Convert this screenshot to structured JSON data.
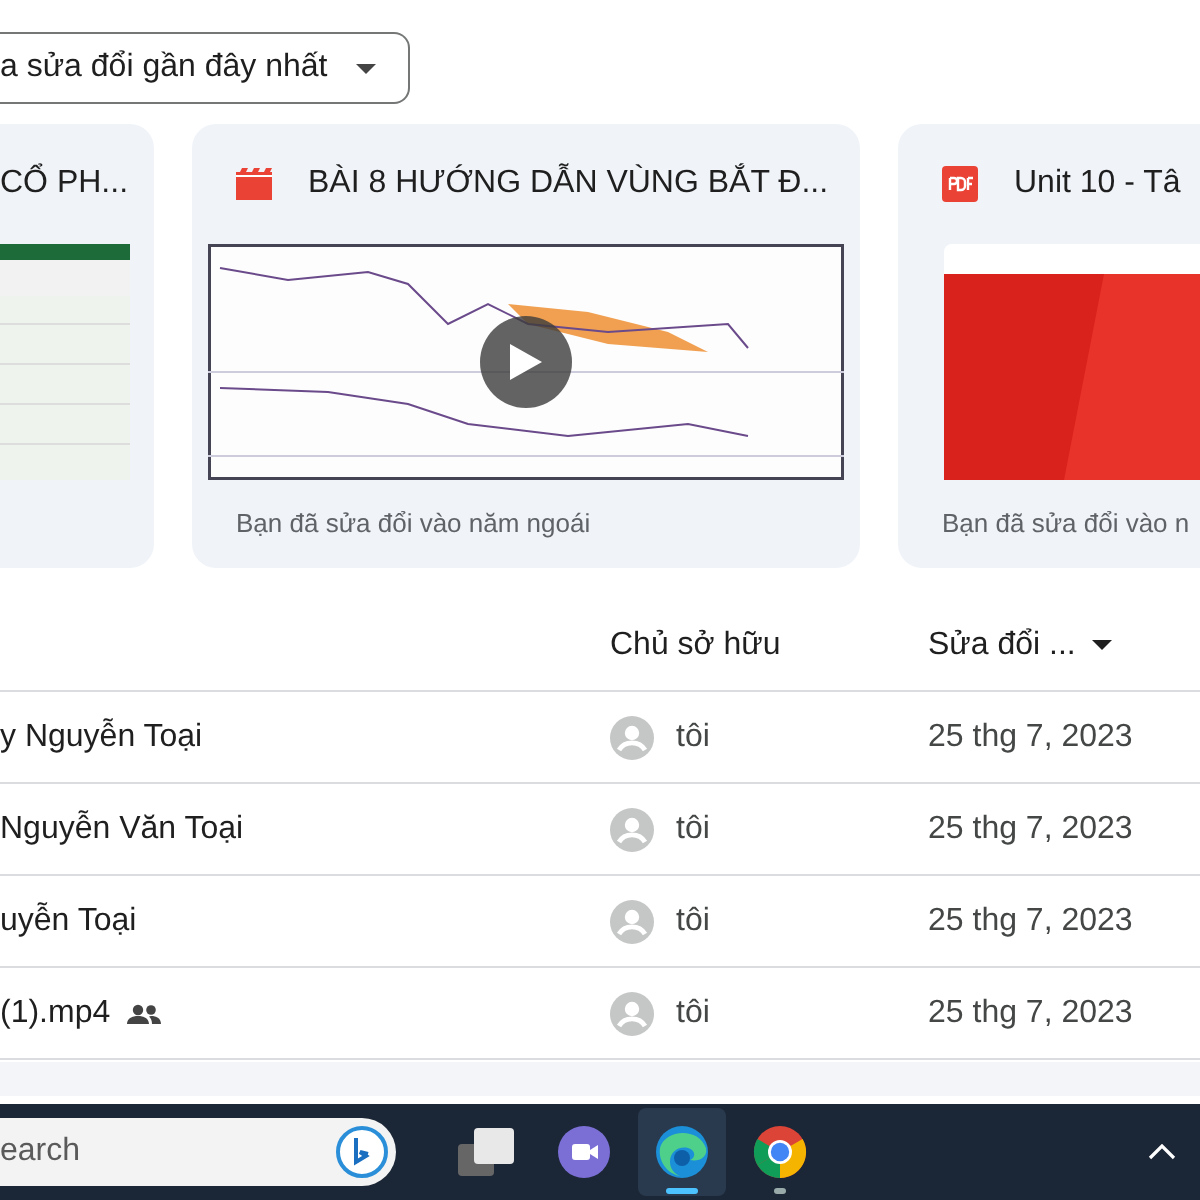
{
  "sort_button": {
    "label": "a sửa đổi gần đây nhất"
  },
  "cards": [
    {
      "kind": "sheet",
      "title": "CỔ PH..."
    },
    {
      "kind": "video",
      "title": "BÀI 8 HƯỚNG DẪN VÙNG BẮT Đ...",
      "caption": "Bạn đã sửa đổi vào năm ngoái"
    },
    {
      "kind": "pdf",
      "title": "Unit 10 - Tâ",
      "caption": "Bạn đã sửa đổi vào n"
    }
  ],
  "table": {
    "columns": [
      "Chủ sở hữu",
      "Sửa đổi ..."
    ],
    "rows": [
      {
        "name": "y Nguyễn Toại",
        "shared": false,
        "owner": "tôi",
        "modified": "25 thg 7, 2023"
      },
      {
        "name": "Nguyễn Văn Toại",
        "shared": false,
        "owner": "tôi",
        "modified": "25 thg 7, 2023"
      },
      {
        "name": "uyễn Toại",
        "shared": false,
        "owner": "tôi",
        "modified": "25 thg 7, 2023"
      },
      {
        "name": "(1).mp4",
        "shared": true,
        "owner": "tôi",
        "modified": "25 thg 7, 2023"
      }
    ]
  },
  "taskbar": {
    "search_placeholder": "earch",
    "apps": [
      {
        "kind": "task-view",
        "selected": false
      },
      {
        "kind": "meet",
        "selected": false
      },
      {
        "kind": "edge",
        "selected": true
      },
      {
        "kind": "chrome",
        "selected": false
      }
    ]
  }
}
